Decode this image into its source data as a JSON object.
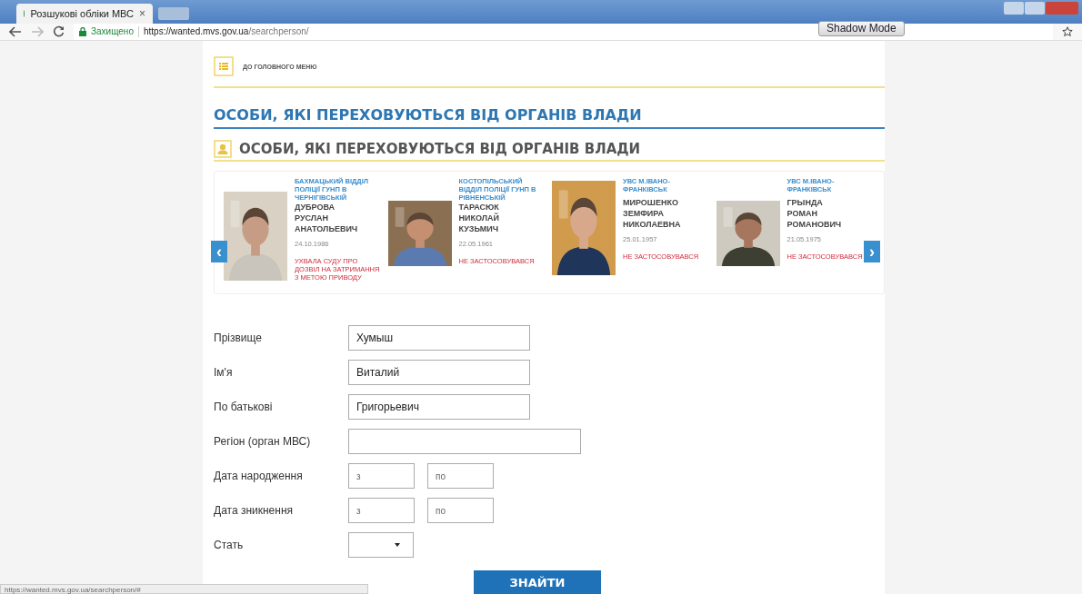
{
  "browser": {
    "tab": {
      "title": "Розшукові обліки МВС",
      "close": "×"
    },
    "secure_label": "Захищено",
    "url_host": "https://wanted.mvs.gov.ua",
    "url_path": "/searchperson/",
    "overlay_button": "Shadow Mode"
  },
  "menu_link": "ДО ГОЛОВНОГО МЕНЮ",
  "page_title": "ОСОБИ, ЯКІ ПЕРЕХОВУЮТЬСЯ ВІД ОРГАНІВ ВЛАДИ",
  "section_title": "ОСОБИ, ЯКІ ПЕРЕХОВУЮТЬСЯ ВІД ОРГАНІВ ВЛАДИ",
  "carousel": {
    "prev": "‹",
    "next": "›",
    "items": [
      {
        "kind": "picture",
        "agency": "БАХМАЦЬКИЙ ВІДДІЛ ПОЛІЦІЇ ГУНП В ЧЕРНІГІВСЬКІЙ",
        "name": [
          "ДУБРОВА",
          "РУСЛАН",
          "АНАТОЛЬЕВИЧ"
        ],
        "birth_date": "24.10.1986",
        "measure": "УХВАЛА СУДУ ПРО ДОЗВІЛ НА ЗАТРИМАННЯ З МЕТОЮ ПРИВОДУ"
      },
      {
        "kind": "picture",
        "agency": "КОСТОПІЛЬСЬКИЙ ВІДДІЛ ПОЛІЦІЇ ГУНП В РІВНЕНСЬКІЙ",
        "name": [
          "ТАРАСЮК",
          "НИКОЛАЙ",
          "КУЗЬМИЧ"
        ],
        "birth_date": "22.05.1961",
        "measure": "НЕ ЗАСТОСОВУВАВСЯ"
      },
      {
        "kind": "picture",
        "agency": "УВС М.ІВАНО-ФРАНКІВСЬК",
        "name": [
          "МИРОШЕНКО",
          "ЗЕМФИРА",
          "НИКОЛАЕВНА"
        ],
        "birth_date": "25.01.1957",
        "measure": "НЕ ЗАСТОСОВУВАВСЯ"
      },
      {
        "kind": "picture",
        "agency": "УВС М.ІВАНО-ФРАНКІВСЬК",
        "name": [
          "ГРЫНДА",
          "РОМАН",
          "РОМАНОВИЧ"
        ],
        "birth_date": "21.05.1975",
        "measure": "НЕ ЗАСТОСОВУВАВСЯ"
      }
    ]
  },
  "form": {
    "fields": [
      {
        "kind": "text",
        "label": "Прізвище",
        "value": "Хумыш"
      },
      {
        "kind": "text",
        "label": "Ім'я",
        "value": "Виталий"
      },
      {
        "kind": "text",
        "label": "По батькові",
        "value": "Григорьевич"
      },
      {
        "kind": "wide",
        "label": "Регіон (орган МВС)"
      },
      {
        "kind": "range",
        "label": "Дата народження",
        "from_placeholder": "з",
        "to_placeholder": "по"
      },
      {
        "kind": "range",
        "label": "Дата зникнення",
        "from_placeholder": "з",
        "to_placeholder": "по"
      },
      {
        "kind": "select",
        "label": "Стать"
      }
    ],
    "submit": "ЗНАЙТИ"
  },
  "status_bar": "https://wanted.mvs.gov.ua/searchperson/#"
}
